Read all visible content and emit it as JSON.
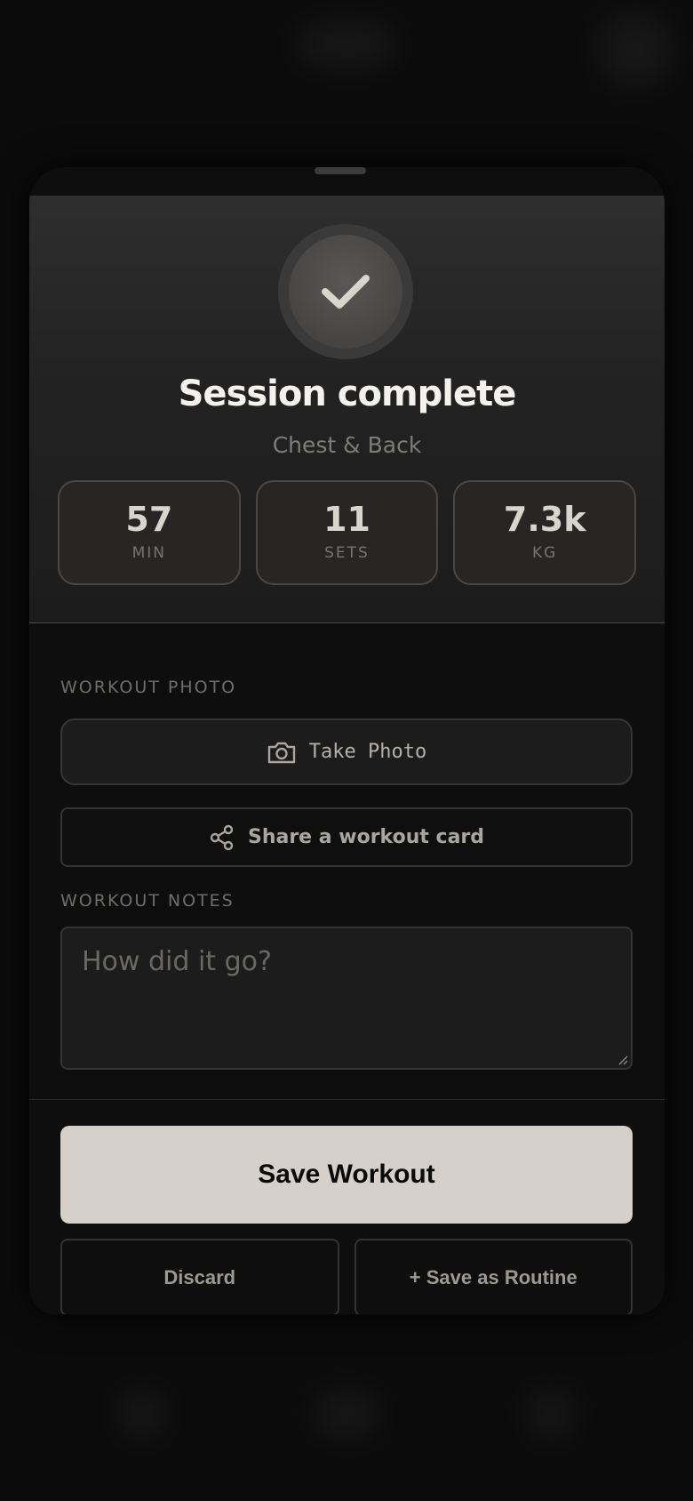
{
  "summary": {
    "title": "Session complete",
    "subtitle": "Chest & Back"
  },
  "stats": [
    {
      "value": "57",
      "unit": "MIN"
    },
    {
      "value": "11",
      "unit": "SETS"
    },
    {
      "value": "7.3k",
      "unit": "KG"
    }
  ],
  "photo": {
    "section_label": "WORKOUT PHOTO",
    "take_photo_label": "Take Photo",
    "share_label": "Share a workout card"
  },
  "notes": {
    "section_label": "WORKOUT NOTES",
    "placeholder": "How did it go?",
    "value": ""
  },
  "actions": {
    "save_label": "Save Workout",
    "discard_label": "Discard",
    "save_routine_label": "+ Save as Routine"
  },
  "icons": {
    "check": "check-icon",
    "camera": "camera-icon",
    "share": "share-icon"
  },
  "colors": {
    "background": "#0b0b0b",
    "primary_button": "#d5d0ca",
    "card": "#272625"
  }
}
